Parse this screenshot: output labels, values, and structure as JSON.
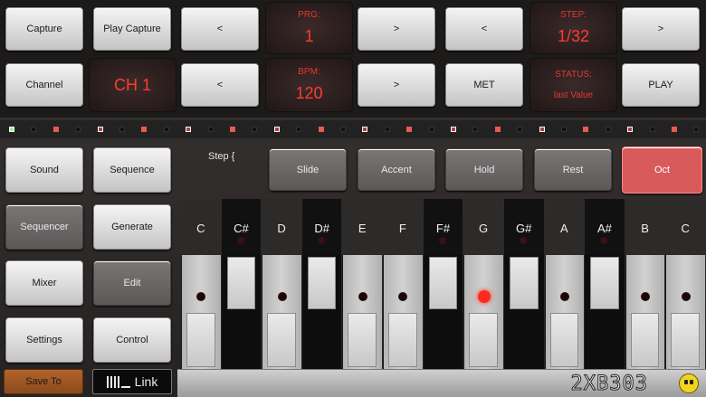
{
  "top_row1": {
    "capture": "Capture",
    "play_capture": "Play Capture",
    "prg_prev": "<",
    "prg_label": "PRG:",
    "prg_value": "1",
    "prg_next": ">",
    "step_prev": "<",
    "step_label": "STEP:",
    "step_value": "1/32",
    "step_next": ">"
  },
  "top_row2": {
    "channel": "Channel",
    "channel_value": "CH 1",
    "bpm_prev": "<",
    "bpm_label": "BPM:",
    "bpm_value": "120",
    "bpm_next": ">",
    "met": "MET",
    "status_label": "STATUS:",
    "status_value": "last Value",
    "play": "PLAY"
  },
  "menu": {
    "sound": "Sound",
    "sequence": "Sequence",
    "sequencer": "Sequencer",
    "generate": "Generate",
    "mixer": "Mixer",
    "edit": "Edit",
    "settings": "Settings",
    "control": "Control",
    "save_to": "Save To",
    "link": "Link"
  },
  "step_label": "Step {",
  "modifiers": {
    "slide": "Slide",
    "accent": "Accent",
    "hold": "Hold",
    "rest": "Rest",
    "oct": "Oct"
  },
  "notes": [
    "C",
    "C#",
    "D",
    "D#",
    "E",
    "F",
    "F#",
    "G",
    "G#",
    "A",
    "A#",
    "B",
    "C"
  ],
  "logo": "2XB303",
  "colors": {
    "accent_red": "#ff3b30",
    "active_mod": "#d85a5a",
    "save_to": "#a0582a"
  },
  "active_note": "G"
}
